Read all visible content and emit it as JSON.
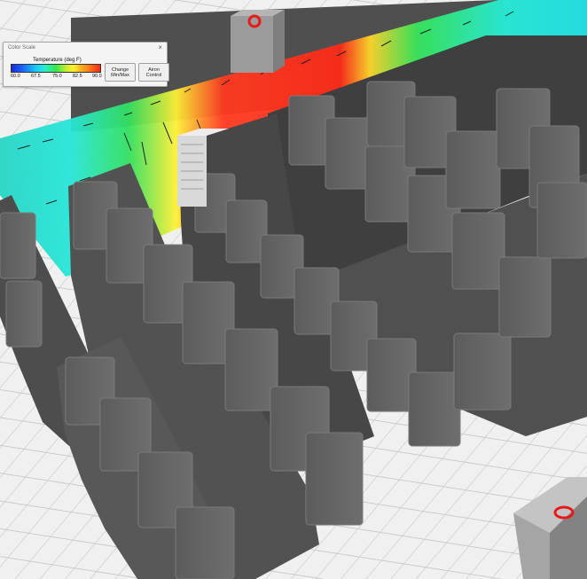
{
  "color_scale": {
    "window_title": "Color Scale",
    "close_glyph": "×",
    "label": "Temperature (deg F)",
    "ticks": [
      "60.0",
      "67.5",
      "75.0",
      "82.5",
      "90.0"
    ],
    "gradient_colors": [
      "#1b2be0",
      "#1a61ff",
      "#19c8ff",
      "#28f0c8",
      "#33e84f",
      "#c7ef2b",
      "#ffee27",
      "#ff9b1e",
      "#ff2a15"
    ],
    "change_button": "Change\nMin/Max",
    "airflow_button": "Airon\nControl"
  },
  "scene": {
    "floor_color": "#e8e8e8",
    "wall_color": "#5a5a5a",
    "rack_top_color": "#8b8b8b",
    "rack_front_color": "#656565",
    "cooling_unit_marker_color": "#e81919"
  }
}
